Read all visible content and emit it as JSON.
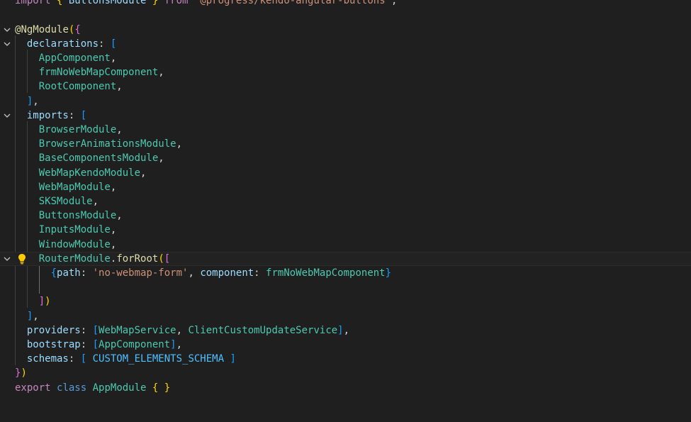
{
  "colors": {
    "background": "#1f1f1f",
    "keyword_control": "#c586c0",
    "keyword": "#569cd6",
    "class_name": "#4ec9b0",
    "function": "#dcdcaa",
    "property": "#9cdcfe",
    "string": "#ce9178",
    "bracket_level1": "#ffd700",
    "bracket_level2": "#da70d6",
    "bracket_level3": "#179fff",
    "constant": "#4fc1ff"
  },
  "editor": {
    "line0": {
      "import_kw": "import",
      "brace_open": " { ",
      "name": "ButtonsModule",
      "brace_close": " } ",
      "from_kw": "from",
      "module_path": " '@progress/kendo-angular-buttons'",
      "semi": ";"
    },
    "line1": {
      "at": "@",
      "decorator": "NgModule",
      "paren": "(",
      "brace": "{"
    },
    "declarations": {
      "key": "declarations",
      "colon": ": ",
      "bracket_open": "[",
      "items": [
        "AppComponent",
        "frmNoWebMapComponent",
        "RootComponent"
      ],
      "bracket_close": "]"
    },
    "imports": {
      "key": "imports",
      "colon": ": ",
      "bracket_open": "[",
      "items": [
        "BrowserModule",
        "BrowserAnimationsModule",
        "BaseComponentsModule",
        "WebMapKendoModule",
        "WebMapModule",
        "SKSModule",
        "ButtonsModule",
        "InputsModule",
        "WindowModule"
      ],
      "router_module": "RouterModule",
      "router_dot": ".",
      "router_fn": "forRoot",
      "router_paren": "(",
      "router_bracket": "[",
      "route_brace_open": "{",
      "route_path_key": "path",
      "route_path_colon": ": ",
      "route_path_value": "'no-webmap-form'",
      "route_comma": ", ",
      "route_component_key": "component",
      "route_component_colon": ": ",
      "route_component_value": "frmNoWebMapComponent",
      "route_brace_close": "}",
      "router_bracket_close": "]",
      "router_paren_close": ")",
      "bracket_close": "]"
    },
    "providers": {
      "key": "providers",
      "colon": ": ",
      "bracket_open": "[",
      "item1": "WebMapService",
      "sep": ", ",
      "item2": "ClientCustomUpdateService",
      "bracket_close": "]"
    },
    "bootstrap": {
      "key": "bootstrap",
      "colon": ": ",
      "bracket_open": "[",
      "item": "AppComponent",
      "bracket_close": "]"
    },
    "schemas": {
      "key": "schemas",
      "colon": ": ",
      "bracket_open": "[ ",
      "item": "CUSTOM_ELEMENTS_SCHEMA",
      "bracket_close": " ]"
    },
    "closing": {
      "brace": "}",
      "paren": ")"
    },
    "export_line": {
      "export_kw": "export",
      "class_kw": "class",
      "class_name": "AppModule",
      "brace_open": "{",
      "brace_close": "}"
    },
    "punct": {
      "comma": ",",
      "space": " "
    },
    "icons": {
      "fold": "chevron-down-icon",
      "lightbulb": "lightbulb-icon"
    }
  }
}
